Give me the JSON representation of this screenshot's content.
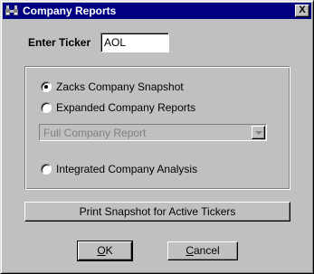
{
  "window": {
    "title": "Company Reports",
    "close_label": "X"
  },
  "ticker": {
    "label": "Enter Ticker",
    "value": "AOL"
  },
  "options": [
    {
      "label": "Zacks Company Snapshot",
      "selected": true
    },
    {
      "label": "Expanded Company Reports",
      "selected": false
    },
    {
      "label": "Integrated Company Analysis",
      "selected": false
    }
  ],
  "report_select": {
    "value": "Full Company Report"
  },
  "print_button": {
    "label": "Print Snapshot for Active Tickers"
  },
  "ok_button": {
    "accel": "O",
    "rest": "K"
  },
  "cancel_button": {
    "accel": "C",
    "rest": "ancel"
  },
  "colors": {
    "titlebar": "#000080",
    "face": "#c0c0c0"
  }
}
